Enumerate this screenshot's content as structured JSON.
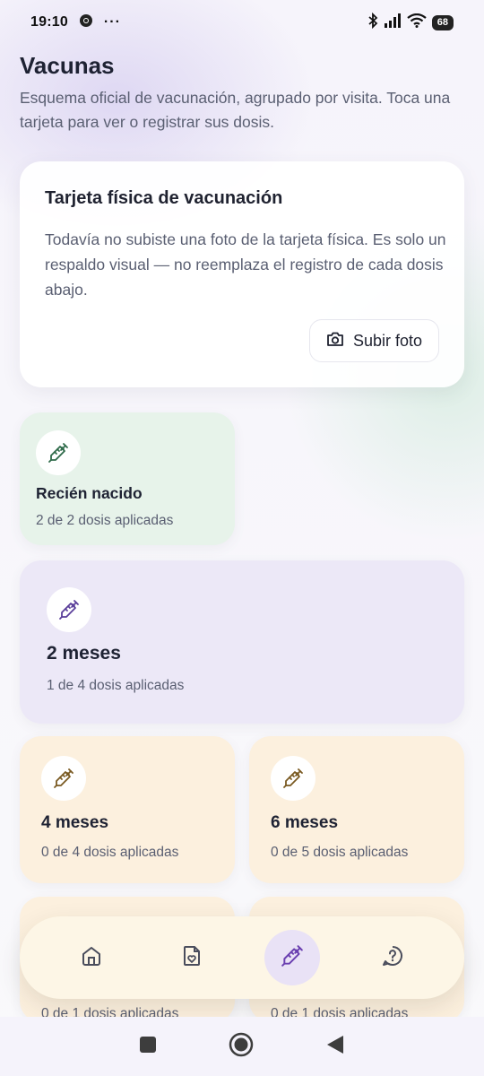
{
  "status": {
    "time": "19:10",
    "battery": "68"
  },
  "page": {
    "title": "Vacunas",
    "subtitle": "Esquema oficial de vacunación, agrupado por visita. Toca una tarjeta para ver o registrar sus dosis."
  },
  "photo_card": {
    "title": "Tarjeta física de vacunación",
    "text": "Todavía no subiste una foto de la tarjeta física. Es solo un respaldo visual — no reemplaza el registro de cada dosis abajo.",
    "button_label": "Subir foto"
  },
  "visits": [
    {
      "title": "Recién nacido",
      "doses": "2 de 2 dosis aplicadas",
      "color": "#e7f3ea",
      "icon_color": "#2f6b4a"
    },
    {
      "title": "2 meses",
      "doses": "1 de 4 dosis aplicadas",
      "color": "#ece8f7",
      "icon_color": "#5b3f9a"
    },
    {
      "title": "4 meses",
      "doses": "0 de 4 dosis aplicadas",
      "color": "#fcf0de",
      "icon_color": "#7a5a22"
    },
    {
      "title": "6 meses",
      "doses": "0 de 5 dosis aplicadas",
      "color": "#fcf0de",
      "icon_color": "#7a5a22"
    },
    {
      "title": "",
      "doses": "0 de 1 dosis aplicadas",
      "color": "#fcf0de",
      "icon_color": "#7a5a22"
    },
    {
      "title": "",
      "doses": "0 de 1 dosis aplicadas",
      "color": "#fcf0de",
      "icon_color": "#7a5a22"
    }
  ],
  "nav": {
    "items": [
      "home-icon",
      "document-heart-icon",
      "syringe-icon",
      "help-chat-icon"
    ],
    "active_index": 2,
    "active_color": "#6a3fb0"
  }
}
